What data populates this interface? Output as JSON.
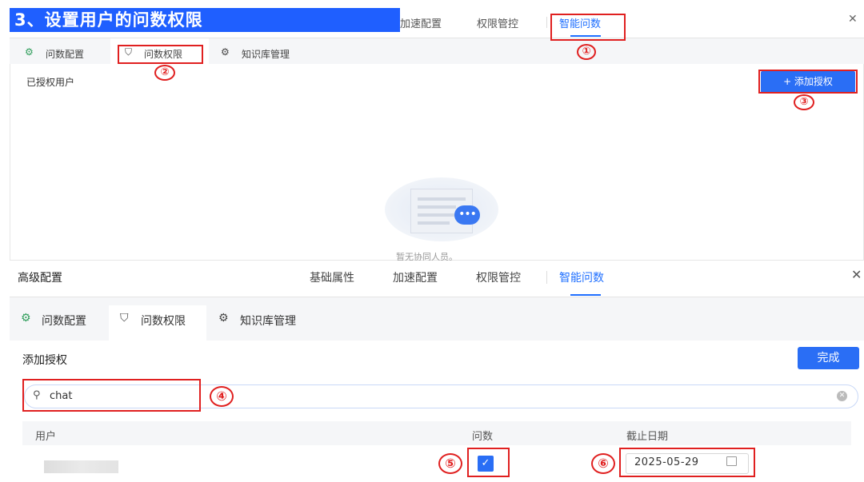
{
  "step_title": "3、设置用户的问数权限",
  "top_panel": {
    "tabs": [
      {
        "label": "加速配置"
      },
      {
        "label": "权限管控"
      },
      {
        "label": "智能问数",
        "active": true
      }
    ],
    "subtabs": [
      {
        "label": "问数配置",
        "icon": "chat-gear-icon"
      },
      {
        "label": "问数权限",
        "icon": "shield-check-icon",
        "active": true
      },
      {
        "label": "知识库管理",
        "icon": "gear-icon"
      }
    ],
    "section_label": "已授权用户",
    "add_button": "+ 添加授权",
    "empty_text": "暂无协同人员。"
  },
  "bottom_panel": {
    "title": "高级配置",
    "tabs": [
      {
        "label": "基础属性"
      },
      {
        "label": "加速配置"
      },
      {
        "label": "权限管控"
      },
      {
        "label": "智能问数",
        "active": true
      }
    ],
    "subtabs": [
      {
        "label": "问数配置",
        "icon": "chat-gear-icon"
      },
      {
        "label": "问数权限",
        "icon": "shield-check-icon",
        "active": true
      },
      {
        "label": "知识库管理",
        "icon": "gear-icon"
      }
    ],
    "section_label": "添加授权",
    "done_button": "完成",
    "search": {
      "value": "chat"
    },
    "table": {
      "columns": [
        "用户",
        "问数",
        "截止日期"
      ],
      "rows": [
        {
          "user": "",
          "ask_enabled": true,
          "deadline": "2025-05-29"
        }
      ]
    }
  },
  "annotations": [
    "①",
    "②",
    "③",
    "④",
    "⑤",
    "⑥"
  ],
  "colors": {
    "accent": "#2a6ef5",
    "annotation": "#e02020",
    "title_bg": "#1f5fff"
  }
}
